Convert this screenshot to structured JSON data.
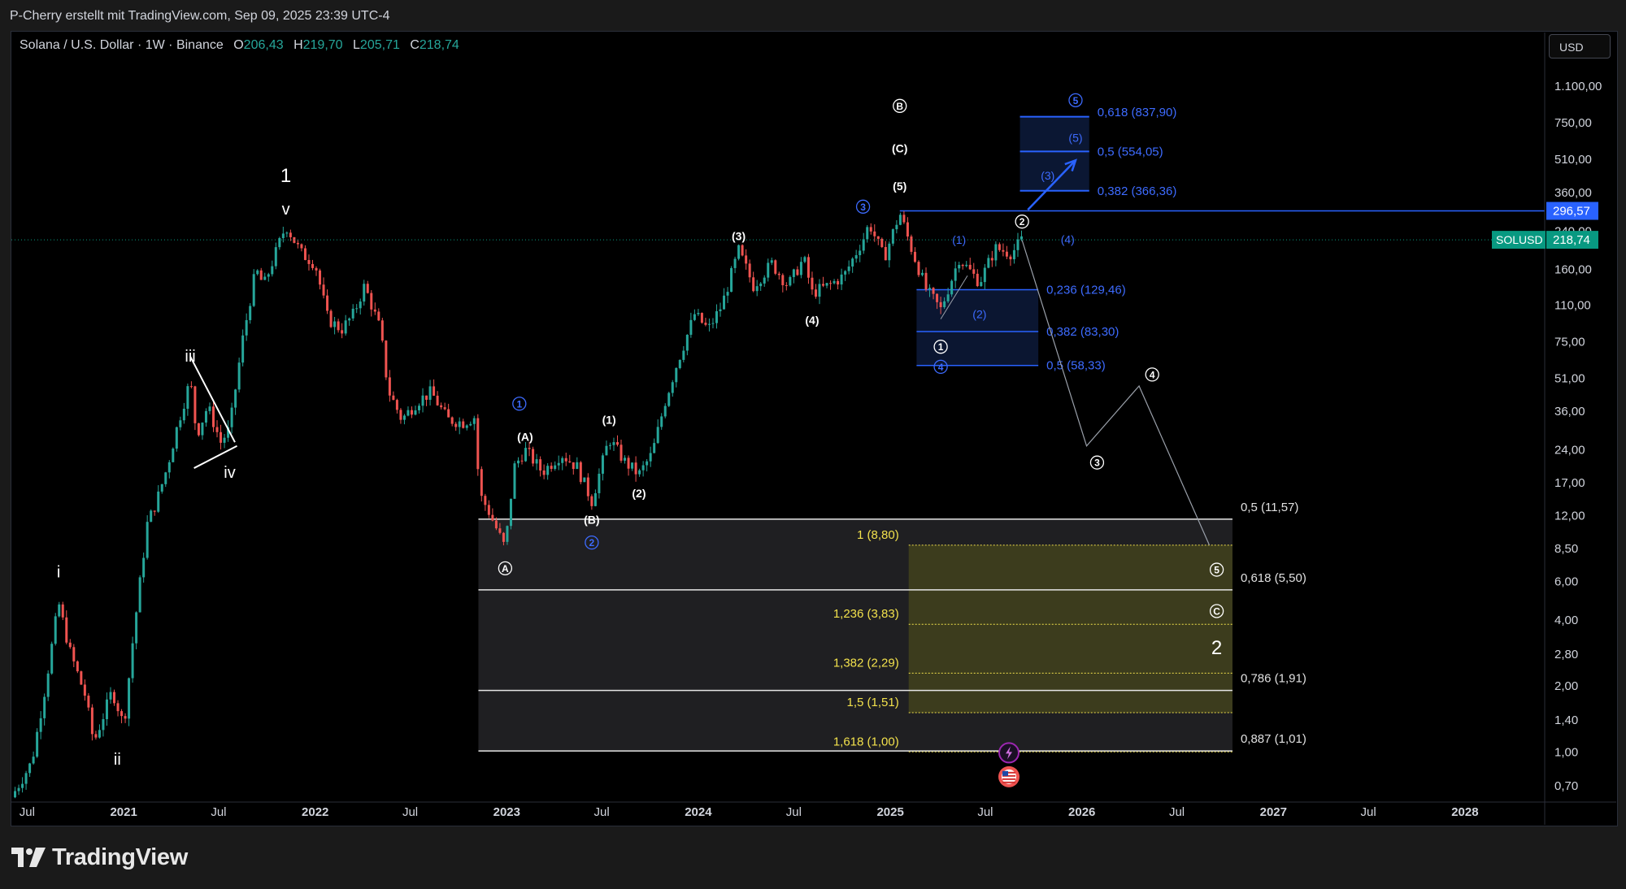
{
  "header": {
    "credit": "P-Cherry erstellt mit TradingView.com, Sep 09, 2025 23:39 UTC-4"
  },
  "symbol_bar": {
    "title": "Solana / U.S. Dollar · 1W · Binance",
    "o_label": "O",
    "o_value": "206,43",
    "h_label": "H",
    "h_value": "219,70",
    "l_label": "L",
    "l_value": "205,71",
    "c_label": "C",
    "c_value": "218,74"
  },
  "currency_button": "USD",
  "brand": {
    "name": "TradingView",
    "icon": "tradingview-logo-icon"
  },
  "colors": {
    "background": "#000000",
    "up": "#26a69a",
    "down": "#ef5350",
    "fib_blue": "#2962ff",
    "fib_yellow": "#f2e14c",
    "price_label": "#2962ff",
    "last_price": "#089981"
  },
  "chart_data": {
    "type": "candlestick",
    "symbol": "SOLUSD",
    "interval": "1W",
    "y_scale": "log",
    "ylim": [
      0.6,
      1400
    ],
    "x_range": [
      "2020-06-01",
      "2028-06-01"
    ],
    "y_ticks": [
      "1.100,00",
      "750,00",
      "510,00",
      "360,00",
      "240,00",
      "160,00",
      "110,00",
      "75,00",
      "51,00",
      "36,00",
      "24,00",
      "17,00",
      "12,00",
      "8,50",
      "6,00",
      "4,00",
      "2,80",
      "2,00",
      "1,40",
      "1,00",
      "0,70"
    ],
    "y_tick_values": [
      1100,
      750,
      510,
      360,
      240,
      160,
      110,
      75,
      51,
      36,
      24,
      17,
      12,
      8.5,
      6,
      4,
      2.8,
      2,
      1.4,
      1,
      0.7
    ],
    "x_ticks": [
      {
        "label": "Jul",
        "date": "2020-07-01",
        "bold": false
      },
      {
        "label": "2021",
        "date": "2021-01-01",
        "bold": true
      },
      {
        "label": "Jul",
        "date": "2021-07-01",
        "bold": false
      },
      {
        "label": "2022",
        "date": "2022-01-01",
        "bold": true
      },
      {
        "label": "Jul",
        "date": "2022-07-01",
        "bold": false
      },
      {
        "label": "2023",
        "date": "2023-01-01",
        "bold": true
      },
      {
        "label": "Jul",
        "date": "2023-07-01",
        "bold": false
      },
      {
        "label": "2024",
        "date": "2024-01-01",
        "bold": true
      },
      {
        "label": "Jul",
        "date": "2024-07-01",
        "bold": false
      },
      {
        "label": "2025",
        "date": "2025-01-01",
        "bold": true
      },
      {
        "label": "Jul",
        "date": "2025-07-01",
        "bold": false
      },
      {
        "label": "2026",
        "date": "2026-01-01",
        "bold": true
      },
      {
        "label": "Jul",
        "date": "2026-07-01",
        "bold": false
      },
      {
        "label": "2027",
        "date": "2027-01-01",
        "bold": true
      },
      {
        "label": "Jul",
        "date": "2027-07-01",
        "bold": false
      },
      {
        "label": "2028",
        "date": "2028-01-01",
        "bold": true
      }
    ],
    "price_path": [
      [
        "2020-06-01",
        0.62
      ],
      [
        "2020-07-10",
        0.9
      ],
      [
        "2020-08-05",
        2.0
      ],
      [
        "2020-08-30",
        4.8
      ],
      [
        "2020-09-20",
        2.9
      ],
      [
        "2020-10-20",
        1.8
      ],
      [
        "2020-11-05",
        1.1
      ],
      [
        "2020-12-10",
        1.9
      ],
      [
        "2020-12-25",
        1.5
      ],
      [
        "2021-01-01",
        1.3
      ],
      [
        "2021-01-20",
        3.5
      ],
      [
        "2021-02-15",
        11.0
      ],
      [
        "2021-03-05",
        14.0
      ],
      [
        "2021-03-25",
        20.0
      ],
      [
        "2021-04-15",
        32.0
      ],
      [
        "2021-05-08",
        50.0
      ],
      [
        "2021-05-20",
        28.0
      ],
      [
        "2021-06-10",
        38.0
      ],
      [
        "2021-07-05",
        26.0
      ],
      [
        "2021-07-22",
        30.0
      ],
      [
        "2021-08-15",
        75.0
      ],
      [
        "2021-09-10",
        160.0
      ],
      [
        "2021-09-25",
        135.0
      ],
      [
        "2021-11-06",
        255.0
      ],
      [
        "2021-12-05",
        190.0
      ],
      [
        "2022-01-01",
        170.0
      ],
      [
        "2022-01-25",
        95.0
      ],
      [
        "2022-02-20",
        85.0
      ],
      [
        "2022-03-15",
        100.0
      ],
      [
        "2022-04-05",
        135.0
      ],
      [
        "2022-05-05",
        85.0
      ],
      [
        "2022-05-20",
        45.0
      ],
      [
        "2022-06-15",
        33.0
      ],
      [
        "2022-07-15",
        40.0
      ],
      [
        "2022-08-10",
        44.0
      ],
      [
        "2022-09-10",
        33.0
      ],
      [
        "2022-10-10",
        32.0
      ],
      [
        "2022-11-01",
        34.0
      ],
      [
        "2022-11-10",
        15.0
      ],
      [
        "2022-11-25",
        13.0
      ],
      [
        "2022-12-29",
        8.5
      ],
      [
        "2023-01-15",
        20.0
      ],
      [
        "2023-02-05",
        24.0
      ],
      [
        "2023-03-10",
        19.0
      ],
      [
        "2023-04-15",
        23.0
      ],
      [
        "2023-05-15",
        20.0
      ],
      [
        "2023-06-12",
        14.0
      ],
      [
        "2023-07-15",
        27.0
      ],
      [
        "2023-08-15",
        21.0
      ],
      [
        "2023-09-10",
        18.5
      ],
      [
        "2023-10-05",
        23.0
      ],
      [
        "2023-10-30",
        40.0
      ],
      [
        "2023-11-20",
        58.0
      ],
      [
        "2023-12-25",
        100.0
      ],
      [
        "2024-01-20",
        85.0
      ],
      [
        "2024-02-15",
        110.0
      ],
      [
        "2024-03-18",
        195.0
      ],
      [
        "2024-04-15",
        135.0
      ],
      [
        "2024-05-20",
        170.0
      ],
      [
        "2024-06-20",
        135.0
      ],
      [
        "2024-07-20",
        180.0
      ],
      [
        "2024-08-05",
        125.0
      ],
      [
        "2024-09-05",
        135.0
      ],
      [
        "2024-10-05",
        150.0
      ],
      [
        "2024-11-10",
        220.0
      ],
      [
        "2024-11-22",
        260.0
      ],
      [
        "2024-12-20",
        180.0
      ],
      [
        "2025-01-19",
        290.0
      ],
      [
        "2025-02-10",
        200.0
      ],
      [
        "2025-03-10",
        130.0
      ],
      [
        "2025-04-07",
        105.0
      ],
      [
        "2025-05-12",
        180.0
      ],
      [
        "2025-06-20",
        140.0
      ],
      [
        "2025-07-20",
        200.0
      ],
      [
        "2025-08-20",
        190.0
      ],
      [
        "2025-09-09",
        218.74
      ]
    ],
    "current_price": {
      "label": "SOLUSD",
      "value": "218,74",
      "y": 218.74
    },
    "price_marker": {
      "value": "296,57",
      "y": 296.57
    },
    "fib_upper_levels": [
      {
        "label": "0,618 (837,90)",
        "y": 837.9
      },
      {
        "label": "0,5 (554,05)",
        "y": 554.05
      },
      {
        "label": "0,382 (366,36)",
        "y": 366.36
      }
    ],
    "fib_mid_levels": [
      {
        "label": "0,236 (129,46)",
        "y": 129.46
      },
      {
        "label": "0,382 (83,30)",
        "y": 83.3
      },
      {
        "label": "0,5 (58,33)",
        "y": 58.33
      }
    ],
    "fib_right_levels": [
      {
        "label": "0,5 (11,57)",
        "y": 11.57
      },
      {
        "label": "0,618 (5,50)",
        "y": 5.5
      },
      {
        "label": "0,786 (1,91)",
        "y": 1.91
      },
      {
        "label": "0,887 (1,01)",
        "y": 1.01
      }
    ],
    "fib_ext_levels": [
      {
        "label": "1 (8,80)",
        "y": 8.8
      },
      {
        "label": "1,236 (3,83)",
        "y": 3.83
      },
      {
        "label": "1,382 (2,29)",
        "y": 2.29
      },
      {
        "label": "1,5 (1,51)",
        "y": 1.51
      },
      {
        "label": "1,618 (1,00)",
        "y": 1.0
      }
    ],
    "projection_path": [
      [
        "2025-09-09",
        218
      ],
      [
        "2026-01-10",
        25
      ],
      [
        "2026-04-20",
        47
      ],
      [
        "2026-09-01",
        8.8
      ]
    ],
    "projection_arrow": [
      [
        "2025-09-20",
        300
      ],
      [
        "2025-12-20",
        505
      ]
    ],
    "wave_labels": [
      {
        "text": "1",
        "d": "2021-11-06",
        "y": 430,
        "style": "big"
      },
      {
        "text": "v",
        "d": "2021-11-06",
        "y": 300,
        "style": "plain"
      },
      {
        "text": "iii",
        "d": "2021-05-08",
        "y": 64,
        "style": "plain"
      },
      {
        "text": "iv",
        "d": "2021-07-22",
        "y": 18.8,
        "style": "plain"
      },
      {
        "text": "i",
        "d": "2020-08-30",
        "y": 6.6,
        "style": "plain"
      },
      {
        "text": "ii",
        "d": "2020-12-20",
        "y": 0.92,
        "style": "plain"
      },
      {
        "text": "A",
        "d": "2022-12-29",
        "y": 6.9,
        "style": "circle-white"
      },
      {
        "text": "1",
        "d": "2023-01-25",
        "y": 39,
        "style": "circle-blue"
      },
      {
        "text": "(A)",
        "d": "2023-02-05",
        "y": 27.5,
        "style": "small"
      },
      {
        "text": "(B)",
        "d": "2023-06-12",
        "y": 11.5,
        "style": "small"
      },
      {
        "text": "2",
        "d": "2023-06-12",
        "y": 9.05,
        "style": "circle-blue"
      },
      {
        "text": "(1)",
        "d": "2023-07-15",
        "y": 33,
        "style": "small"
      },
      {
        "text": "(2)",
        "d": "2023-09-10",
        "y": 15.2,
        "style": "small"
      },
      {
        "text": "(3)",
        "d": "2024-03-18",
        "y": 228,
        "style": "small"
      },
      {
        "text": "(4)",
        "d": "2024-08-05",
        "y": 94,
        "style": "small"
      },
      {
        "text": "3",
        "d": "2024-11-10",
        "y": 310,
        "style": "circle-blue"
      },
      {
        "text": "(5)",
        "d": "2025-01-19",
        "y": 385,
        "style": "small"
      },
      {
        "text": "(C)",
        "d": "2025-01-19",
        "y": 572,
        "style": "small"
      },
      {
        "text": "B",
        "d": "2025-01-19",
        "y": 895,
        "style": "circle-white"
      },
      {
        "text": "(1)",
        "d": "2025-05-12",
        "y": 219,
        "style": "small-blue"
      },
      {
        "text": "(2)",
        "d": "2025-06-20",
        "y": 100,
        "style": "small-blue"
      },
      {
        "text": "1",
        "d": "2025-04-07",
        "y": 71,
        "style": "circle-white"
      },
      {
        "text": "4",
        "d": "2025-04-07",
        "y": 57.5,
        "style": "circle-blue"
      },
      {
        "text": "2",
        "d": "2025-09-09",
        "y": 265,
        "style": "circle-white"
      },
      {
        "text": "(4)",
        "d": "2025-12-05",
        "y": 220,
        "style": "small-blue"
      },
      {
        "text": "(3)",
        "d": "2025-10-28",
        "y": 430,
        "style": "small-blue"
      },
      {
        "text": "(5)",
        "d": "2025-12-20",
        "y": 640,
        "style": "small-blue"
      },
      {
        "text": "5",
        "d": "2025-12-20",
        "y": 950,
        "style": "circle-blue"
      },
      {
        "text": "4",
        "d": "2026-05-15",
        "y": 53,
        "style": "circle-white"
      },
      {
        "text": "3",
        "d": "2026-01-30",
        "y": 21,
        "style": "circle-white"
      },
      {
        "text": "5",
        "d": "2026-09-15",
        "y": 6.8,
        "style": "circle-white"
      },
      {
        "text": "C",
        "d": "2026-09-15",
        "y": 4.4,
        "style": "circle-white"
      },
      {
        "text": "2",
        "d": "2026-09-15",
        "y": 3.0,
        "style": "big"
      }
    ],
    "event_icons": [
      {
        "name": "flash-event-icon",
        "d": "2025-08-15",
        "y": 0.99
      },
      {
        "name": "us-flag-event-icon",
        "d": "2025-08-15",
        "y": 0.77
      }
    ]
  }
}
